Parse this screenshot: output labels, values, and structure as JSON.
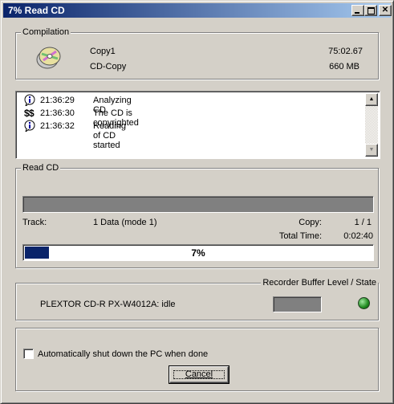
{
  "window": {
    "title": "7% Read CD"
  },
  "compilation": {
    "group_label": "Compilation",
    "source": "Copy1",
    "target": "CD-Copy",
    "duration": "75:02.67",
    "size": "660 MB"
  },
  "log": [
    {
      "icon": "info-icon",
      "time": "21:36:29",
      "message": "Analyzing CD"
    },
    {
      "icon": "copyright-dollar-icon",
      "time": "21:36:30",
      "message": "The CD is copyrighted"
    },
    {
      "icon": "info-icon",
      "time": "21:36:32",
      "message": "Reading of CD started"
    }
  ],
  "read_cd": {
    "group_label": "Read CD",
    "track_label": "Track:",
    "track_value": "1  Data (mode 1)",
    "copy_label": "Copy:",
    "copy_value": "1 / 1",
    "total_time_label": "Total Time:",
    "total_time_value": "0:02:40",
    "progress_text": "7%",
    "progress_fraction": 0.07
  },
  "recorder": {
    "group_label": "Recorder Buffer Level / State",
    "device": "PLEXTOR CD-R  PX-W4012A:  idle",
    "led_color": "#1f8a1f"
  },
  "options": {
    "auto_shutdown_label": "Automatically shut down the PC when done",
    "auto_shutdown_checked": false,
    "cancel_label": "Cancel"
  },
  "colors": {
    "title_start": "#0a246a",
    "title_end": "#a6caf0",
    "progress": "#0a246a",
    "face": "#d4d0c8"
  }
}
